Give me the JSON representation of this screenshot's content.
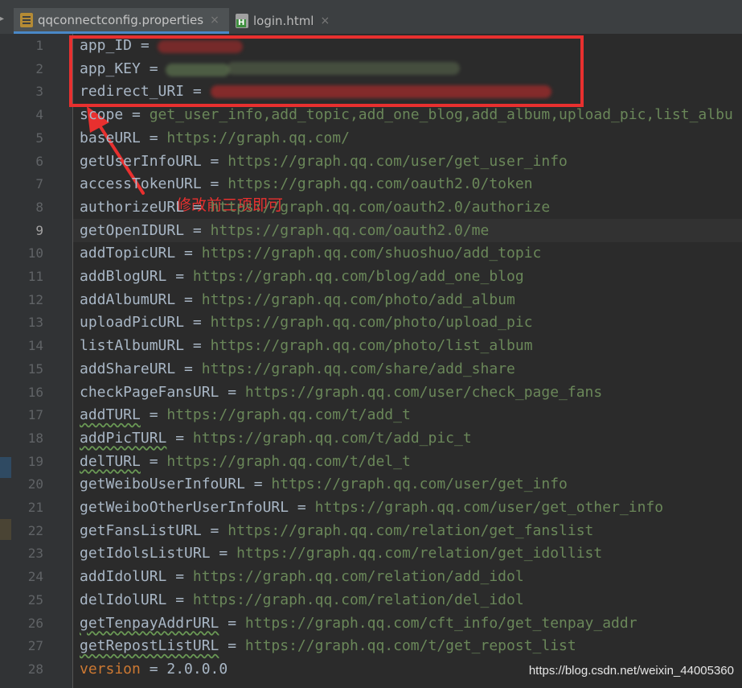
{
  "tabs": [
    {
      "label": "qqconnectconfig.properties",
      "icon": "properties-file-icon",
      "active": true
    },
    {
      "label": "login.html",
      "icon": "html-file-icon",
      "active": false
    }
  ],
  "tab_close_glyph": "×",
  "annotation": {
    "text": "修改前三项即可",
    "color": "#e8302f"
  },
  "watermark": "https://blog.csdn.net/weixin_44005360",
  "current_line": 9,
  "lines": [
    {
      "n": "1",
      "key": "app_ID",
      "eq": " = ",
      "value": ""
    },
    {
      "n": "2",
      "key": "app_KEY",
      "eq": " = ",
      "value": ""
    },
    {
      "n": "3",
      "key": "redirect_URI",
      "eq": " = ",
      "value": ""
    },
    {
      "n": "4",
      "key": "scope",
      "eq": " = ",
      "value": "get_user_info,add_topic,add_one_blog,add_album,upload_pic,list_albu"
    },
    {
      "n": "5",
      "key": "baseURL",
      "eq": " = ",
      "value": "https://graph.qq.com/"
    },
    {
      "n": "6",
      "key": "getUserInfoURL",
      "eq": " = ",
      "value": "https://graph.qq.com/user/get_user_info"
    },
    {
      "n": "7",
      "key": "accessTokenURL",
      "eq": " = ",
      "value": "https://graph.qq.com/oauth2.0/token"
    },
    {
      "n": "8",
      "key": "authorizeURL",
      "eq": " = ",
      "value": "https://graph.qq.com/oauth2.0/authorize"
    },
    {
      "n": "9",
      "key": "getOpenIDURL",
      "eq": " = ",
      "value": "https://graph.qq.com/oauth2.0/me"
    },
    {
      "n": "10",
      "key": "addTopicURL",
      "eq": " = ",
      "value": "https://graph.qq.com/shuoshuo/add_topic"
    },
    {
      "n": "11",
      "key": "addBlogURL",
      "eq": " = ",
      "value": "https://graph.qq.com/blog/add_one_blog"
    },
    {
      "n": "12",
      "key": "addAlbumURL",
      "eq": " = ",
      "value": "https://graph.qq.com/photo/add_album"
    },
    {
      "n": "13",
      "key": "uploadPicURL",
      "eq": " = ",
      "value": "https://graph.qq.com/photo/upload_pic"
    },
    {
      "n": "14",
      "key": "listAlbumURL",
      "eq": " = ",
      "value": "https://graph.qq.com/photo/list_album"
    },
    {
      "n": "15",
      "key": "addShareURL",
      "eq": " = ",
      "value": "https://graph.qq.com/share/add_share"
    },
    {
      "n": "16",
      "key": "checkPageFansURL",
      "eq": " = ",
      "value": "https://graph.qq.com/user/check_page_fans"
    },
    {
      "n": "17",
      "key": "addTURL",
      "eq": " = ",
      "value": "https://graph.qq.com/t/add_t"
    },
    {
      "n": "18",
      "key": "addPicTURL",
      "eq": " = ",
      "value": "https://graph.qq.com/t/add_pic_t"
    },
    {
      "n": "19",
      "key": "delTURL",
      "eq": " = ",
      "value": "https://graph.qq.com/t/del_t"
    },
    {
      "n": "20",
      "key": "getWeiboUserInfoURL",
      "eq": " = ",
      "value": "https://graph.qq.com/user/get_info"
    },
    {
      "n": "21",
      "key": "getWeiboOtherUserInfoURL",
      "eq": " = ",
      "value": "https://graph.qq.com/user/get_other_info"
    },
    {
      "n": "22",
      "key": "getFansListURL",
      "eq": " = ",
      "value": "https://graph.qq.com/relation/get_fanslist"
    },
    {
      "n": "23",
      "key": "getIdolsListURL",
      "eq": " = ",
      "value": "https://graph.qq.com/relation/get_idollist"
    },
    {
      "n": "24",
      "key": "addIdolURL",
      "eq": " = ",
      "value": "https://graph.qq.com/relation/add_idol"
    },
    {
      "n": "25",
      "key": "delIdolURL",
      "eq": " = ",
      "value": "https://graph.qq.com/relation/del_idol"
    },
    {
      "n": "26",
      "key": "getTenpayAddrURL",
      "eq": " = ",
      "value": "https://graph.qq.com/cft_info/get_tenpay_addr"
    },
    {
      "n": "27",
      "key": "getRepostListURL",
      "eq": " = ",
      "value": "https://graph.qq.com/t/get_repost_list"
    },
    {
      "n": "28",
      "key": "version",
      "eq": " = ",
      "value": "2.0.0.0"
    }
  ]
}
